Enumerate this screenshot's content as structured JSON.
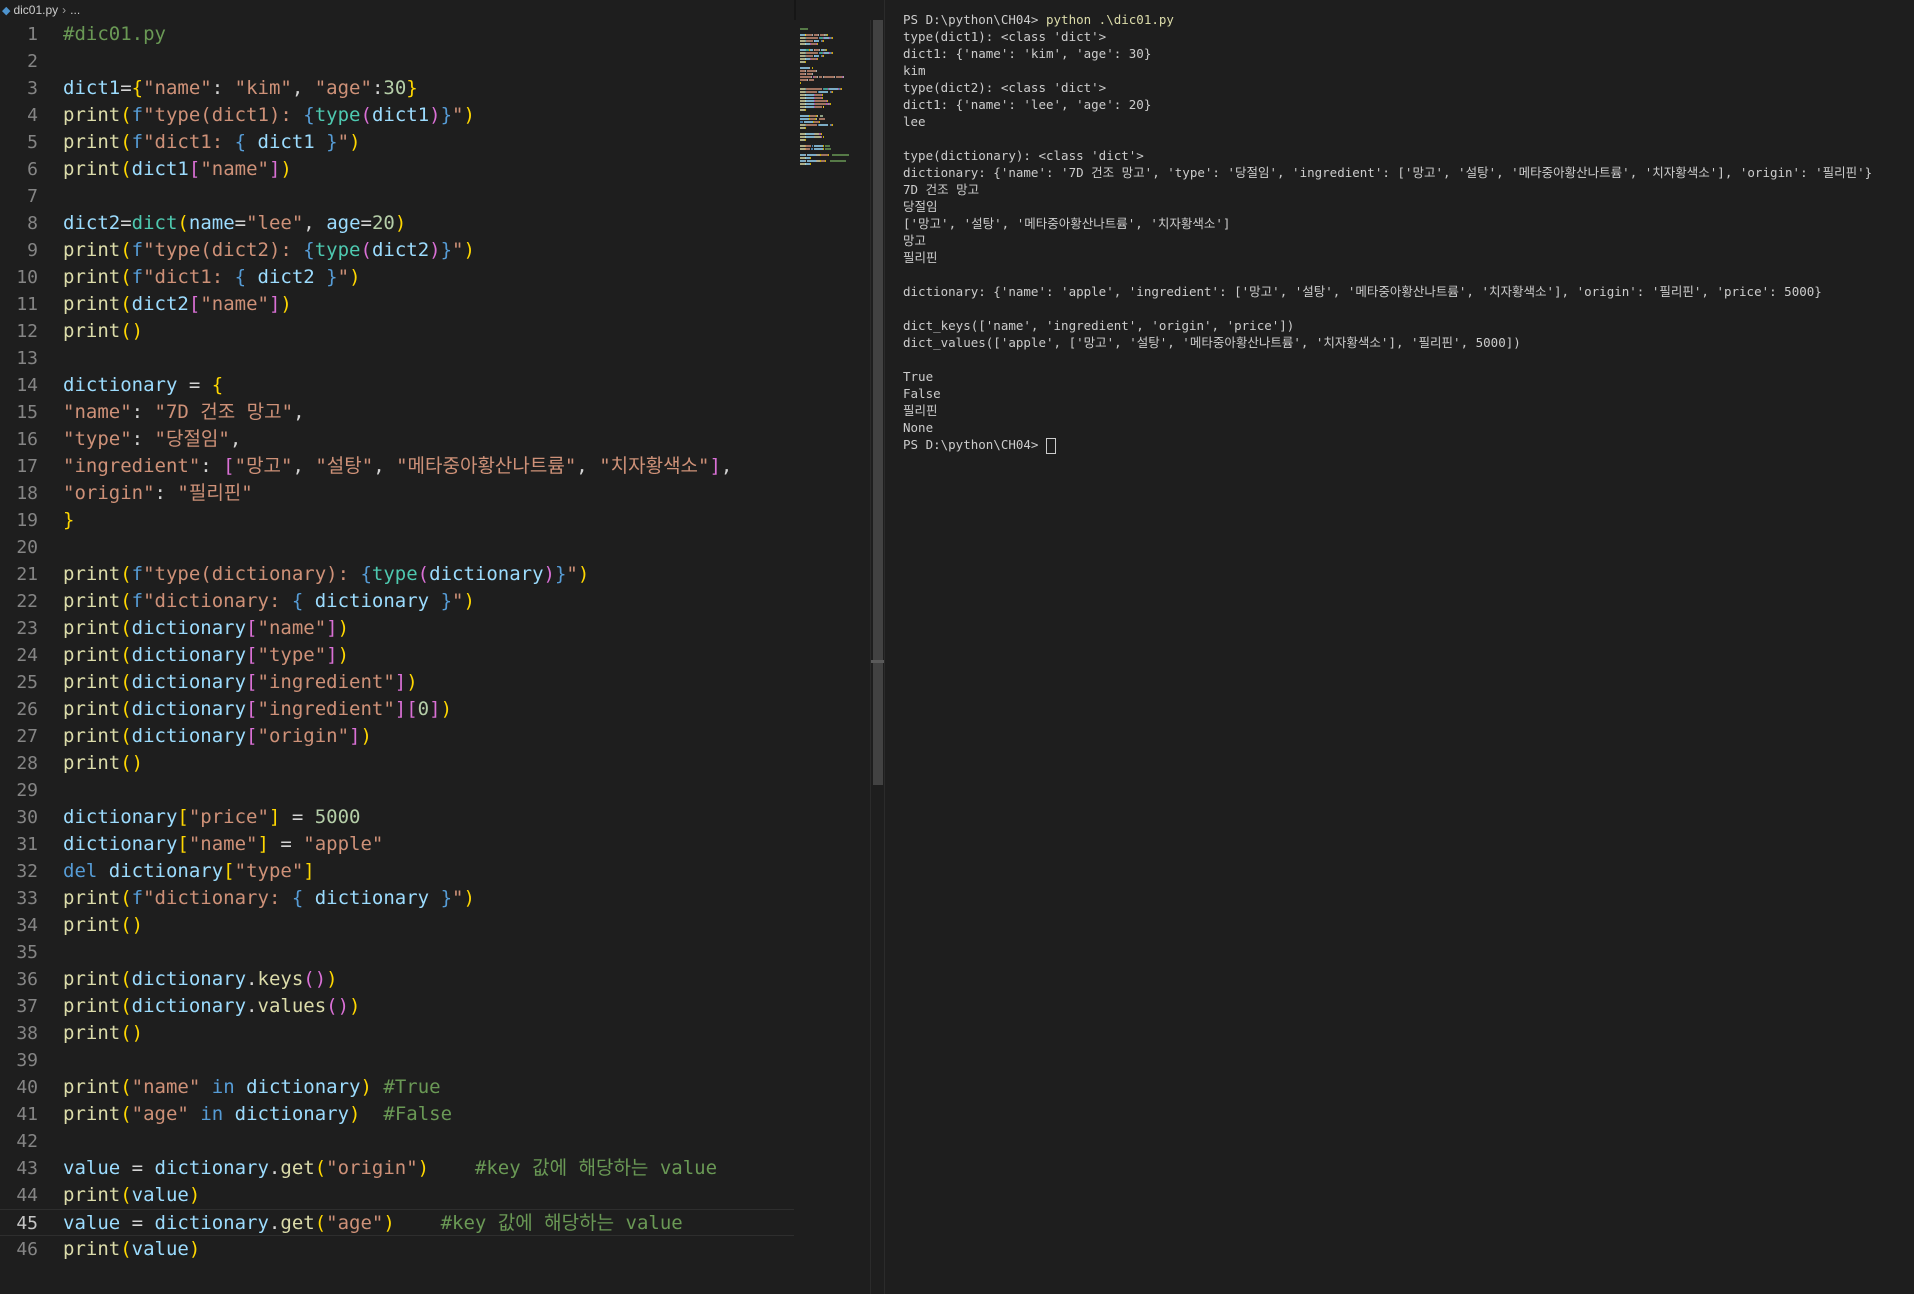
{
  "breadcrumb": {
    "file": "dic01.py",
    "rest": "..."
  },
  "code_lines": [
    {
      "num": "1",
      "tokens": [
        [
          "c",
          "#dic01.py"
        ]
      ]
    },
    {
      "num": "2",
      "tokens": []
    },
    {
      "num": "3",
      "tokens": [
        [
          "v",
          "dict1"
        ],
        [
          "o",
          "="
        ],
        [
          "b1",
          "{"
        ],
        [
          "s",
          "\"name\""
        ],
        [
          "o",
          ": "
        ],
        [
          "s",
          "\"kim\""
        ],
        [
          "o",
          ", "
        ],
        [
          "s",
          "\"age\""
        ],
        [
          "o",
          ":"
        ],
        [
          "n",
          "30"
        ],
        [
          "b1",
          "}"
        ]
      ]
    },
    {
      "num": "4",
      "tokens": [
        [
          "f",
          "print"
        ],
        [
          "b1",
          "("
        ],
        [
          "kw",
          "f"
        ],
        [
          "s",
          "\"type(dict1): "
        ],
        [
          "kw",
          "{"
        ],
        [
          "t",
          "type"
        ],
        [
          "b2",
          "("
        ],
        [
          "v",
          "dict1"
        ],
        [
          "b2",
          ")"
        ],
        [
          "kw",
          "}"
        ],
        [
          "s",
          "\""
        ],
        [
          "b1",
          ")"
        ]
      ]
    },
    {
      "num": "5",
      "tokens": [
        [
          "f",
          "print"
        ],
        [
          "b1",
          "("
        ],
        [
          "kw",
          "f"
        ],
        [
          "s",
          "\"dict1: "
        ],
        [
          "kw",
          "{"
        ],
        [
          "v",
          " dict1 "
        ],
        [
          "kw",
          "}"
        ],
        [
          "s",
          "\""
        ],
        [
          "b1",
          ")"
        ]
      ]
    },
    {
      "num": "6",
      "tokens": [
        [
          "f",
          "print"
        ],
        [
          "b1",
          "("
        ],
        [
          "v",
          "dict1"
        ],
        [
          "b2",
          "["
        ],
        [
          "s",
          "\"name\""
        ],
        [
          "b2",
          "]"
        ],
        [
          "b1",
          ")"
        ]
      ]
    },
    {
      "num": "7",
      "tokens": []
    },
    {
      "num": "8",
      "tokens": [
        [
          "v",
          "dict2"
        ],
        [
          "o",
          "="
        ],
        [
          "t",
          "dict"
        ],
        [
          "b1",
          "("
        ],
        [
          "v",
          "name"
        ],
        [
          "o",
          "="
        ],
        [
          "s",
          "\"lee\""
        ],
        [
          "o",
          ", "
        ],
        [
          "v",
          "age"
        ],
        [
          "o",
          "="
        ],
        [
          "n",
          "20"
        ],
        [
          "b1",
          ")"
        ]
      ]
    },
    {
      "num": "9",
      "tokens": [
        [
          "f",
          "print"
        ],
        [
          "b1",
          "("
        ],
        [
          "kw",
          "f"
        ],
        [
          "s",
          "\"type(dict2): "
        ],
        [
          "kw",
          "{"
        ],
        [
          "t",
          "type"
        ],
        [
          "b2",
          "("
        ],
        [
          "v",
          "dict2"
        ],
        [
          "b2",
          ")"
        ],
        [
          "kw",
          "}"
        ],
        [
          "s",
          "\""
        ],
        [
          "b1",
          ")"
        ]
      ]
    },
    {
      "num": "10",
      "tokens": [
        [
          "f",
          "print"
        ],
        [
          "b1",
          "("
        ],
        [
          "kw",
          "f"
        ],
        [
          "s",
          "\"dict1: "
        ],
        [
          "kw",
          "{"
        ],
        [
          "v",
          " dict2 "
        ],
        [
          "kw",
          "}"
        ],
        [
          "s",
          "\""
        ],
        [
          "b1",
          ")"
        ]
      ]
    },
    {
      "num": "11",
      "tokens": [
        [
          "f",
          "print"
        ],
        [
          "b1",
          "("
        ],
        [
          "v",
          "dict2"
        ],
        [
          "b2",
          "["
        ],
        [
          "s",
          "\"name\""
        ],
        [
          "b2",
          "]"
        ],
        [
          "b1",
          ")"
        ]
      ]
    },
    {
      "num": "12",
      "tokens": [
        [
          "f",
          "print"
        ],
        [
          "b1",
          "()"
        ]
      ]
    },
    {
      "num": "13",
      "tokens": []
    },
    {
      "num": "14",
      "tokens": [
        [
          "v",
          "dictionary"
        ],
        [
          "o",
          " = "
        ],
        [
          "b1",
          "{"
        ]
      ]
    },
    {
      "num": "15",
      "tokens": [
        [
          "s",
          "\"name\""
        ],
        [
          "o",
          ": "
        ],
        [
          "s",
          "\"7D 건조 망고\""
        ],
        [
          "o",
          ","
        ]
      ]
    },
    {
      "num": "16",
      "tokens": [
        [
          "s",
          "\"type\""
        ],
        [
          "o",
          ": "
        ],
        [
          "s",
          "\"당절임\""
        ],
        [
          "o",
          ","
        ]
      ]
    },
    {
      "num": "17",
      "tokens": [
        [
          "s",
          "\"ingredient\""
        ],
        [
          "o",
          ": "
        ],
        [
          "b2",
          "["
        ],
        [
          "s",
          "\"망고\""
        ],
        [
          "o",
          ", "
        ],
        [
          "s",
          "\"설탕\""
        ],
        [
          "o",
          ", "
        ],
        [
          "s",
          "\"메타중아황산나트륨\""
        ],
        [
          "o",
          ", "
        ],
        [
          "s",
          "\"치자황색소\""
        ],
        [
          "b2",
          "]"
        ],
        [
          "o",
          ","
        ]
      ]
    },
    {
      "num": "18",
      "tokens": [
        [
          "s",
          "\"origin\""
        ],
        [
          "o",
          ": "
        ],
        [
          "s",
          "\"필리핀\""
        ]
      ]
    },
    {
      "num": "19",
      "tokens": [
        [
          "b1",
          "}"
        ]
      ]
    },
    {
      "num": "20",
      "tokens": []
    },
    {
      "num": "21",
      "tokens": [
        [
          "f",
          "print"
        ],
        [
          "b1",
          "("
        ],
        [
          "kw",
          "f"
        ],
        [
          "s",
          "\"type(dictionary): "
        ],
        [
          "kw",
          "{"
        ],
        [
          "t",
          "type"
        ],
        [
          "b2",
          "("
        ],
        [
          "v",
          "dictionary"
        ],
        [
          "b2",
          ")"
        ],
        [
          "kw",
          "}"
        ],
        [
          "s",
          "\""
        ],
        [
          "b1",
          ")"
        ]
      ]
    },
    {
      "num": "22",
      "tokens": [
        [
          "f",
          "print"
        ],
        [
          "b1",
          "("
        ],
        [
          "kw",
          "f"
        ],
        [
          "s",
          "\"dictionary: "
        ],
        [
          "kw",
          "{"
        ],
        [
          "v",
          " dictionary "
        ],
        [
          "kw",
          "}"
        ],
        [
          "s",
          "\""
        ],
        [
          "b1",
          ")"
        ]
      ]
    },
    {
      "num": "23",
      "tokens": [
        [
          "f",
          "print"
        ],
        [
          "b1",
          "("
        ],
        [
          "v",
          "dictionary"
        ],
        [
          "b2",
          "["
        ],
        [
          "s",
          "\"name\""
        ],
        [
          "b2",
          "]"
        ],
        [
          "b1",
          ")"
        ]
      ]
    },
    {
      "num": "24",
      "tokens": [
        [
          "f",
          "print"
        ],
        [
          "b1",
          "("
        ],
        [
          "v",
          "dictionary"
        ],
        [
          "b2",
          "["
        ],
        [
          "s",
          "\"type\""
        ],
        [
          "b2",
          "]"
        ],
        [
          "b1",
          ")"
        ]
      ]
    },
    {
      "num": "25",
      "tokens": [
        [
          "f",
          "print"
        ],
        [
          "b1",
          "("
        ],
        [
          "v",
          "dictionary"
        ],
        [
          "b2",
          "["
        ],
        [
          "s",
          "\"ingredient\""
        ],
        [
          "b2",
          "]"
        ],
        [
          "b1",
          ")"
        ]
      ]
    },
    {
      "num": "26",
      "tokens": [
        [
          "f",
          "print"
        ],
        [
          "b1",
          "("
        ],
        [
          "v",
          "dictionary"
        ],
        [
          "b2",
          "["
        ],
        [
          "s",
          "\"ingredient\""
        ],
        [
          "b2",
          "]["
        ],
        [
          "n",
          "0"
        ],
        [
          "b2",
          "]"
        ],
        [
          "b1",
          ")"
        ]
      ]
    },
    {
      "num": "27",
      "tokens": [
        [
          "f",
          "print"
        ],
        [
          "b1",
          "("
        ],
        [
          "v",
          "dictionary"
        ],
        [
          "b2",
          "["
        ],
        [
          "s",
          "\"origin\""
        ],
        [
          "b2",
          "]"
        ],
        [
          "b1",
          ")"
        ]
      ]
    },
    {
      "num": "28",
      "tokens": [
        [
          "f",
          "print"
        ],
        [
          "b1",
          "()"
        ]
      ]
    },
    {
      "num": "29",
      "tokens": []
    },
    {
      "num": "30",
      "tokens": [
        [
          "v",
          "dictionary"
        ],
        [
          "b1",
          "["
        ],
        [
          "s",
          "\"price\""
        ],
        [
          "b1",
          "]"
        ],
        [
          "o",
          " = "
        ],
        [
          "n",
          "5000"
        ]
      ]
    },
    {
      "num": "31",
      "tokens": [
        [
          "v",
          "dictionary"
        ],
        [
          "b1",
          "["
        ],
        [
          "s",
          "\"name\""
        ],
        [
          "b1",
          "]"
        ],
        [
          "o",
          " = "
        ],
        [
          "s",
          "\"apple\""
        ]
      ]
    },
    {
      "num": "32",
      "tokens": [
        [
          "kw",
          "del"
        ],
        [
          "o",
          " "
        ],
        [
          "v",
          "dictionary"
        ],
        [
          "b1",
          "["
        ],
        [
          "s",
          "\"type\""
        ],
        [
          "b1",
          "]"
        ]
      ]
    },
    {
      "num": "33",
      "tokens": [
        [
          "f",
          "print"
        ],
        [
          "b1",
          "("
        ],
        [
          "kw",
          "f"
        ],
        [
          "s",
          "\"dictionary: "
        ],
        [
          "kw",
          "{"
        ],
        [
          "v",
          " dictionary "
        ],
        [
          "kw",
          "}"
        ],
        [
          "s",
          "\""
        ],
        [
          "b1",
          ")"
        ]
      ]
    },
    {
      "num": "34",
      "tokens": [
        [
          "f",
          "print"
        ],
        [
          "b1",
          "()"
        ]
      ]
    },
    {
      "num": "35",
      "tokens": []
    },
    {
      "num": "36",
      "tokens": [
        [
          "f",
          "print"
        ],
        [
          "b1",
          "("
        ],
        [
          "v",
          "dictionary"
        ],
        [
          "o",
          "."
        ],
        [
          "f",
          "keys"
        ],
        [
          "b2",
          "()"
        ],
        [
          "b1",
          ")"
        ]
      ]
    },
    {
      "num": "37",
      "tokens": [
        [
          "f",
          "print"
        ],
        [
          "b1",
          "("
        ],
        [
          "v",
          "dictionary"
        ],
        [
          "o",
          "."
        ],
        [
          "f",
          "values"
        ],
        [
          "b2",
          "()"
        ],
        [
          "b1",
          ")"
        ]
      ]
    },
    {
      "num": "38",
      "tokens": [
        [
          "f",
          "print"
        ],
        [
          "b1",
          "()"
        ]
      ]
    },
    {
      "num": "39",
      "tokens": []
    },
    {
      "num": "40",
      "tokens": [
        [
          "f",
          "print"
        ],
        [
          "b1",
          "("
        ],
        [
          "s",
          "\"name\""
        ],
        [
          "o",
          " "
        ],
        [
          "kw",
          "in"
        ],
        [
          "o",
          " "
        ],
        [
          "v",
          "dictionary"
        ],
        [
          "b1",
          ")"
        ],
        [
          "o",
          " "
        ],
        [
          "c",
          "#True"
        ]
      ]
    },
    {
      "num": "41",
      "tokens": [
        [
          "f",
          "print"
        ],
        [
          "b1",
          "("
        ],
        [
          "s",
          "\"age\""
        ],
        [
          "o",
          " "
        ],
        [
          "kw",
          "in"
        ],
        [
          "o",
          " "
        ],
        [
          "v",
          "dictionary"
        ],
        [
          "b1",
          ")"
        ],
        [
          "o",
          "  "
        ],
        [
          "c",
          "#False"
        ]
      ]
    },
    {
      "num": "42",
      "tokens": []
    },
    {
      "num": "43",
      "tokens": [
        [
          "v",
          "value"
        ],
        [
          "o",
          " = "
        ],
        [
          "v",
          "dictionary"
        ],
        [
          "o",
          "."
        ],
        [
          "f",
          "get"
        ],
        [
          "b1",
          "("
        ],
        [
          "s",
          "\"origin\""
        ],
        [
          "b1",
          ")"
        ],
        [
          "o",
          "    "
        ],
        [
          "c",
          "#key 값에 해당하는 value"
        ]
      ]
    },
    {
      "num": "44",
      "tokens": [
        [
          "f",
          "print"
        ],
        [
          "b1",
          "("
        ],
        [
          "v",
          "value"
        ],
        [
          "b1",
          ")"
        ]
      ]
    },
    {
      "num": "45",
      "current": true,
      "tokens": [
        [
          "v",
          "value"
        ],
        [
          "o",
          " = "
        ],
        [
          "v",
          "dictionary"
        ],
        [
          "o",
          "."
        ],
        [
          "f",
          "get"
        ],
        [
          "b1",
          "("
        ],
        [
          "s",
          "\"age\""
        ],
        [
          "b1",
          ")"
        ],
        [
          "o",
          "    "
        ],
        [
          "c",
          "#key 값에 해당하는 value"
        ]
      ]
    },
    {
      "num": "46",
      "tokens": [
        [
          "f",
          "print"
        ],
        [
          "b1",
          "("
        ],
        [
          "v",
          "value"
        ],
        [
          "b1",
          ")"
        ]
      ]
    }
  ],
  "terminal": {
    "prompt": "PS D:\\python\\CH04> ",
    "command": "python .\\dic01.py",
    "lines": [
      "type(dict1): <class 'dict'>",
      "dict1: {'name': 'kim', 'age': 30}",
      "kim",
      "type(dict2): <class 'dict'>",
      "dict1: {'name': 'lee', 'age': 20}",
      "lee",
      "",
      "type(dictionary): <class 'dict'>",
      "dictionary: {'name': '7D 건조 망고', 'type': '당절임', 'ingredient': ['망고', '설탕', '메타중아황산나트륨', '치자황색소'], 'origin': '필리핀'}",
      "7D 건조 망고",
      "당절임",
      "['망고', '설탕', '메타중아황산나트륨', '치자황색소']",
      "망고",
      "필리핀",
      "",
      "dictionary: {'name': 'apple', 'ingredient': ['망고', '설탕', '메타중아황산나트륨', '치자황색소'], 'origin': '필리핀', 'price': 5000}",
      "",
      "dict_keys(['name', 'ingredient', 'origin', 'price'])",
      "dict_values(['apple', ['망고', '설탕', '메타중아황산나트륨', '치자황색소'], '필리핀', 5000])",
      "",
      "True",
      "False",
      "필리핀",
      "None"
    ],
    "final_prompt": "PS D:\\python\\CH04> "
  }
}
